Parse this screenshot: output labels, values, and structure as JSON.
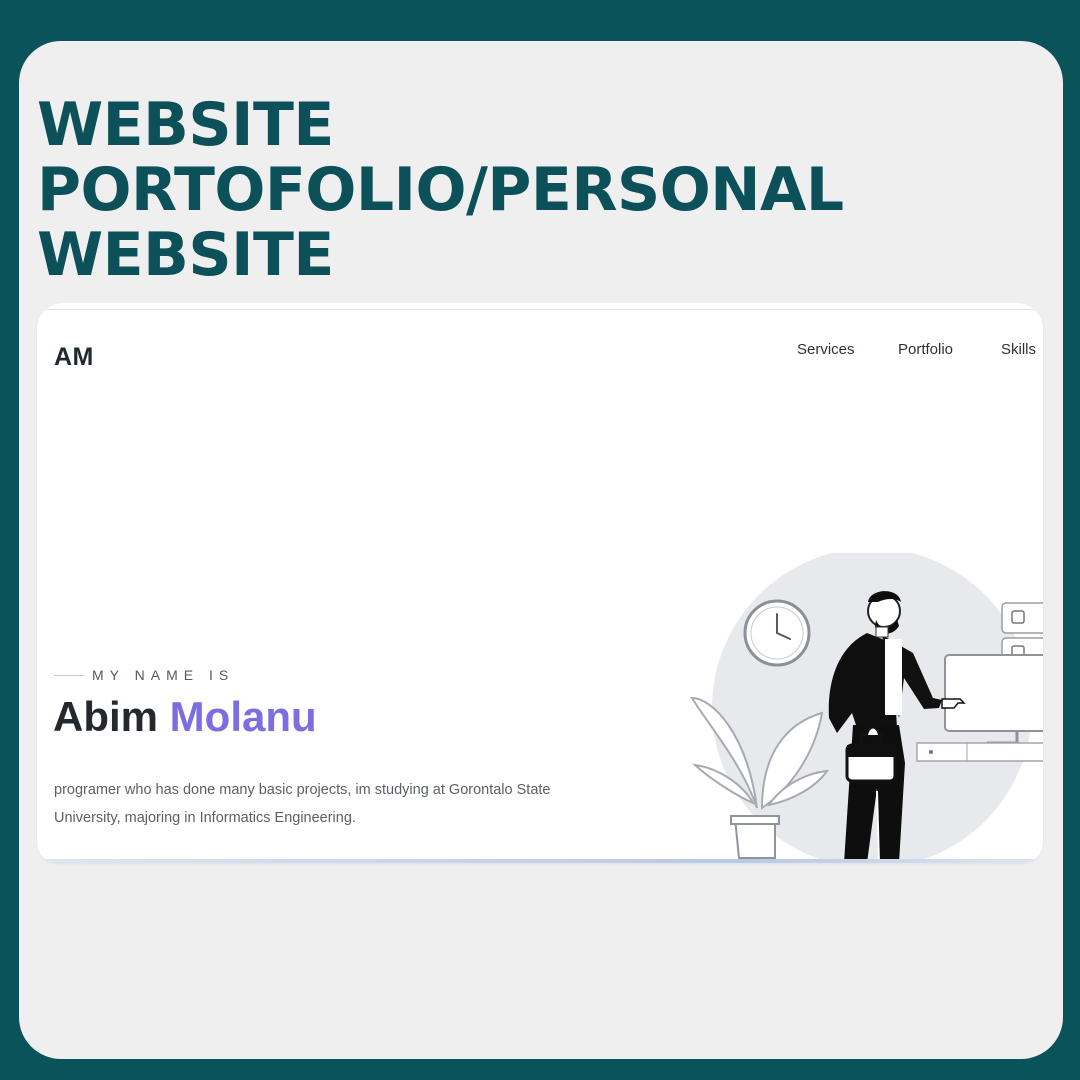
{
  "promo": {
    "title": "WEBSITE\nPORTOFOLIO/PERSONAL\nWEBSITE"
  },
  "site": {
    "logo": "AM",
    "nav": [
      "Services",
      "Portfolio",
      "Skills"
    ],
    "hero": {
      "intro": "MY NAME IS",
      "first_name": "Abim",
      "last_name": "Molanu",
      "description": "programer who has done many basic projects, im studying at Gorontalo State University, majoring in Informatics Engineering."
    }
  },
  "colors": {
    "background": "#0b535b",
    "card": "#efeff0",
    "title": "#0c5159",
    "accent": "#7a6ee0",
    "text": "#23292e"
  },
  "icons": [
    "clock-icon",
    "plant-icon",
    "person-illustration",
    "monitor-icon",
    "chat-bubble-icon",
    "briefcase-icon"
  ]
}
